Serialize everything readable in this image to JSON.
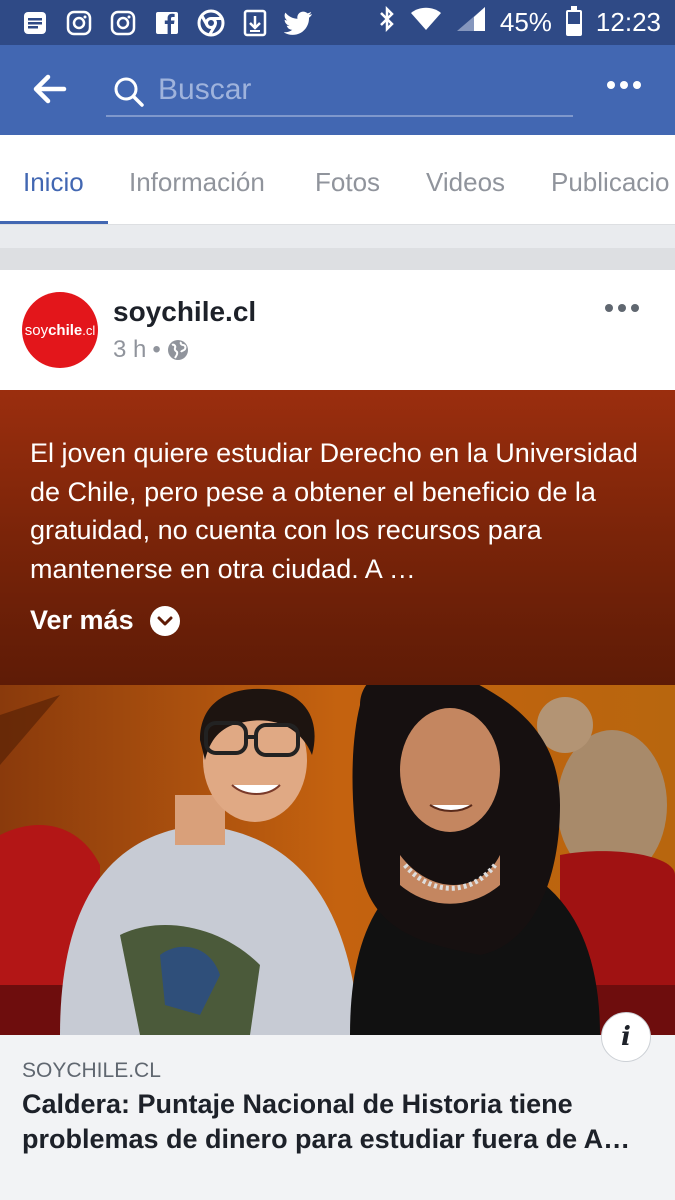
{
  "status_bar": {
    "left_icons": [
      "notes-icon",
      "instagram-icon",
      "instagram-icon",
      "facebook-icon",
      "chrome-icon",
      "download-icon",
      "twitter-icon"
    ],
    "battery": "45%",
    "time": "12:23"
  },
  "app_bar": {
    "search_placeholder": "Buscar"
  },
  "tabs": [
    {
      "label": "Inicio",
      "active": true
    },
    {
      "label": "Información",
      "active": false
    },
    {
      "label": "Fotos",
      "active": false
    },
    {
      "label": "Videos",
      "active": false
    },
    {
      "label": "Publicacio",
      "active": false
    }
  ],
  "post": {
    "avatar_text_light": "soy",
    "avatar_text_bold": "chile",
    "avatar_text_suffix": ".cl",
    "page_name": "soychile.cl",
    "time": "3 h",
    "dot": "•",
    "body": "El joven quiere estudiar Derecho en la Universidad de Chile, pero pese a obtener el beneficio de la gratuidad, no cuenta con los recursos para mantenerse en otra ciudad. A …",
    "see_more": "Ver más",
    "link": {
      "domain": "SOYCHILE.CL",
      "headline_line1": "Caldera: Puntaje Nacional de Historia tiene",
      "headline_line2": "problemas de dinero para estudiar fuera de A…"
    },
    "info_glyph": "i"
  },
  "colors": {
    "status_bar": "#2f4a86",
    "app_bar": "#4267b2",
    "accent": "#4267b2",
    "avatar": "#e3161b"
  }
}
